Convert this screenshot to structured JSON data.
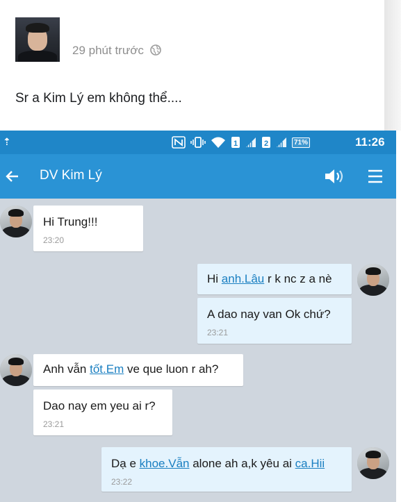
{
  "post": {
    "time": "29 phút trước",
    "text": "Sr a Kim Lý em không thể...."
  },
  "statusbar": {
    "left_glyph": "⇡",
    "battery": "71%",
    "time": "11:26",
    "sim1": "1",
    "sim2": "2"
  },
  "toolbar": {
    "title": "DV Kim Lý"
  },
  "messages": [
    {
      "side": "in",
      "text": "Hi Trung!!!",
      "time": "23:20"
    },
    {
      "side": "out",
      "parts": [
        "Hi ",
        "anh.Lâu",
        " r k nc z a nè"
      ]
    },
    {
      "side": "out",
      "text": "A dao nay van Ok chứ?",
      "time": "23:21"
    },
    {
      "side": "in",
      "parts": [
        "Anh vẫn ",
        "tốt.Em",
        " ve que luon r ah?"
      ]
    },
    {
      "side": "in",
      "text": "Dao nay em yeu ai r?",
      "time": "23:21"
    },
    {
      "side": "out",
      "parts": [
        "Dạ e ",
        "khoe.Vẫn",
        " alone ah a,k yêu ai ",
        "ca.Hii"
      ],
      "time": "23:22"
    }
  ],
  "colors": {
    "statusbar": "#1f86c8",
    "toolbar": "#2a93d5",
    "chat_bg": "#cfd6de",
    "bubble_in": "#ffffff",
    "bubble_out": "#e4f3fd",
    "link": "#1a7fc1"
  }
}
